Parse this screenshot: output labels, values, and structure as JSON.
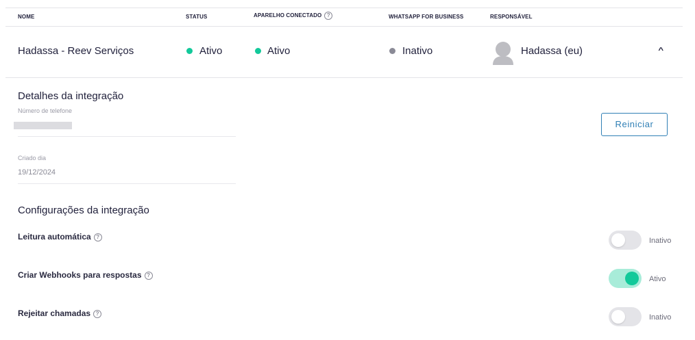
{
  "table": {
    "headers": {
      "nome": "NOME",
      "status": "STATUS",
      "aparelho": "APARELHO CONECTADO",
      "whatsapp": "WHATSAPP FOR BUSINESS",
      "responsavel": "RESPONSÁVEL"
    },
    "row": {
      "nome": "Hadassa - Reev Serviços",
      "status": "Ativo",
      "aparelho": "Ativo",
      "whatsapp": "Inativo",
      "responsavel": "Hadassa (eu)"
    }
  },
  "icons": {
    "help": "?",
    "chevron": "^"
  },
  "colors": {
    "active": "#12c99a",
    "inactive": "#8a8a96",
    "accent": "#2f7fb5"
  },
  "details": {
    "title": "Detalhes da integração",
    "phone_label": "Número de telefone",
    "created_label": "Criado dia",
    "created_value": "19/12/2024",
    "restart_label": "Reiniciar"
  },
  "settings": {
    "title": "Configurações da integração",
    "items": [
      {
        "label": "Leitura automática",
        "enabled": false,
        "state_label": "Inativo"
      },
      {
        "label": "Criar Webhooks para respostas",
        "enabled": true,
        "state_label": "Ativo"
      },
      {
        "label": "Rejeitar chamadas",
        "enabled": false,
        "state_label": "Inativo"
      }
    ]
  }
}
